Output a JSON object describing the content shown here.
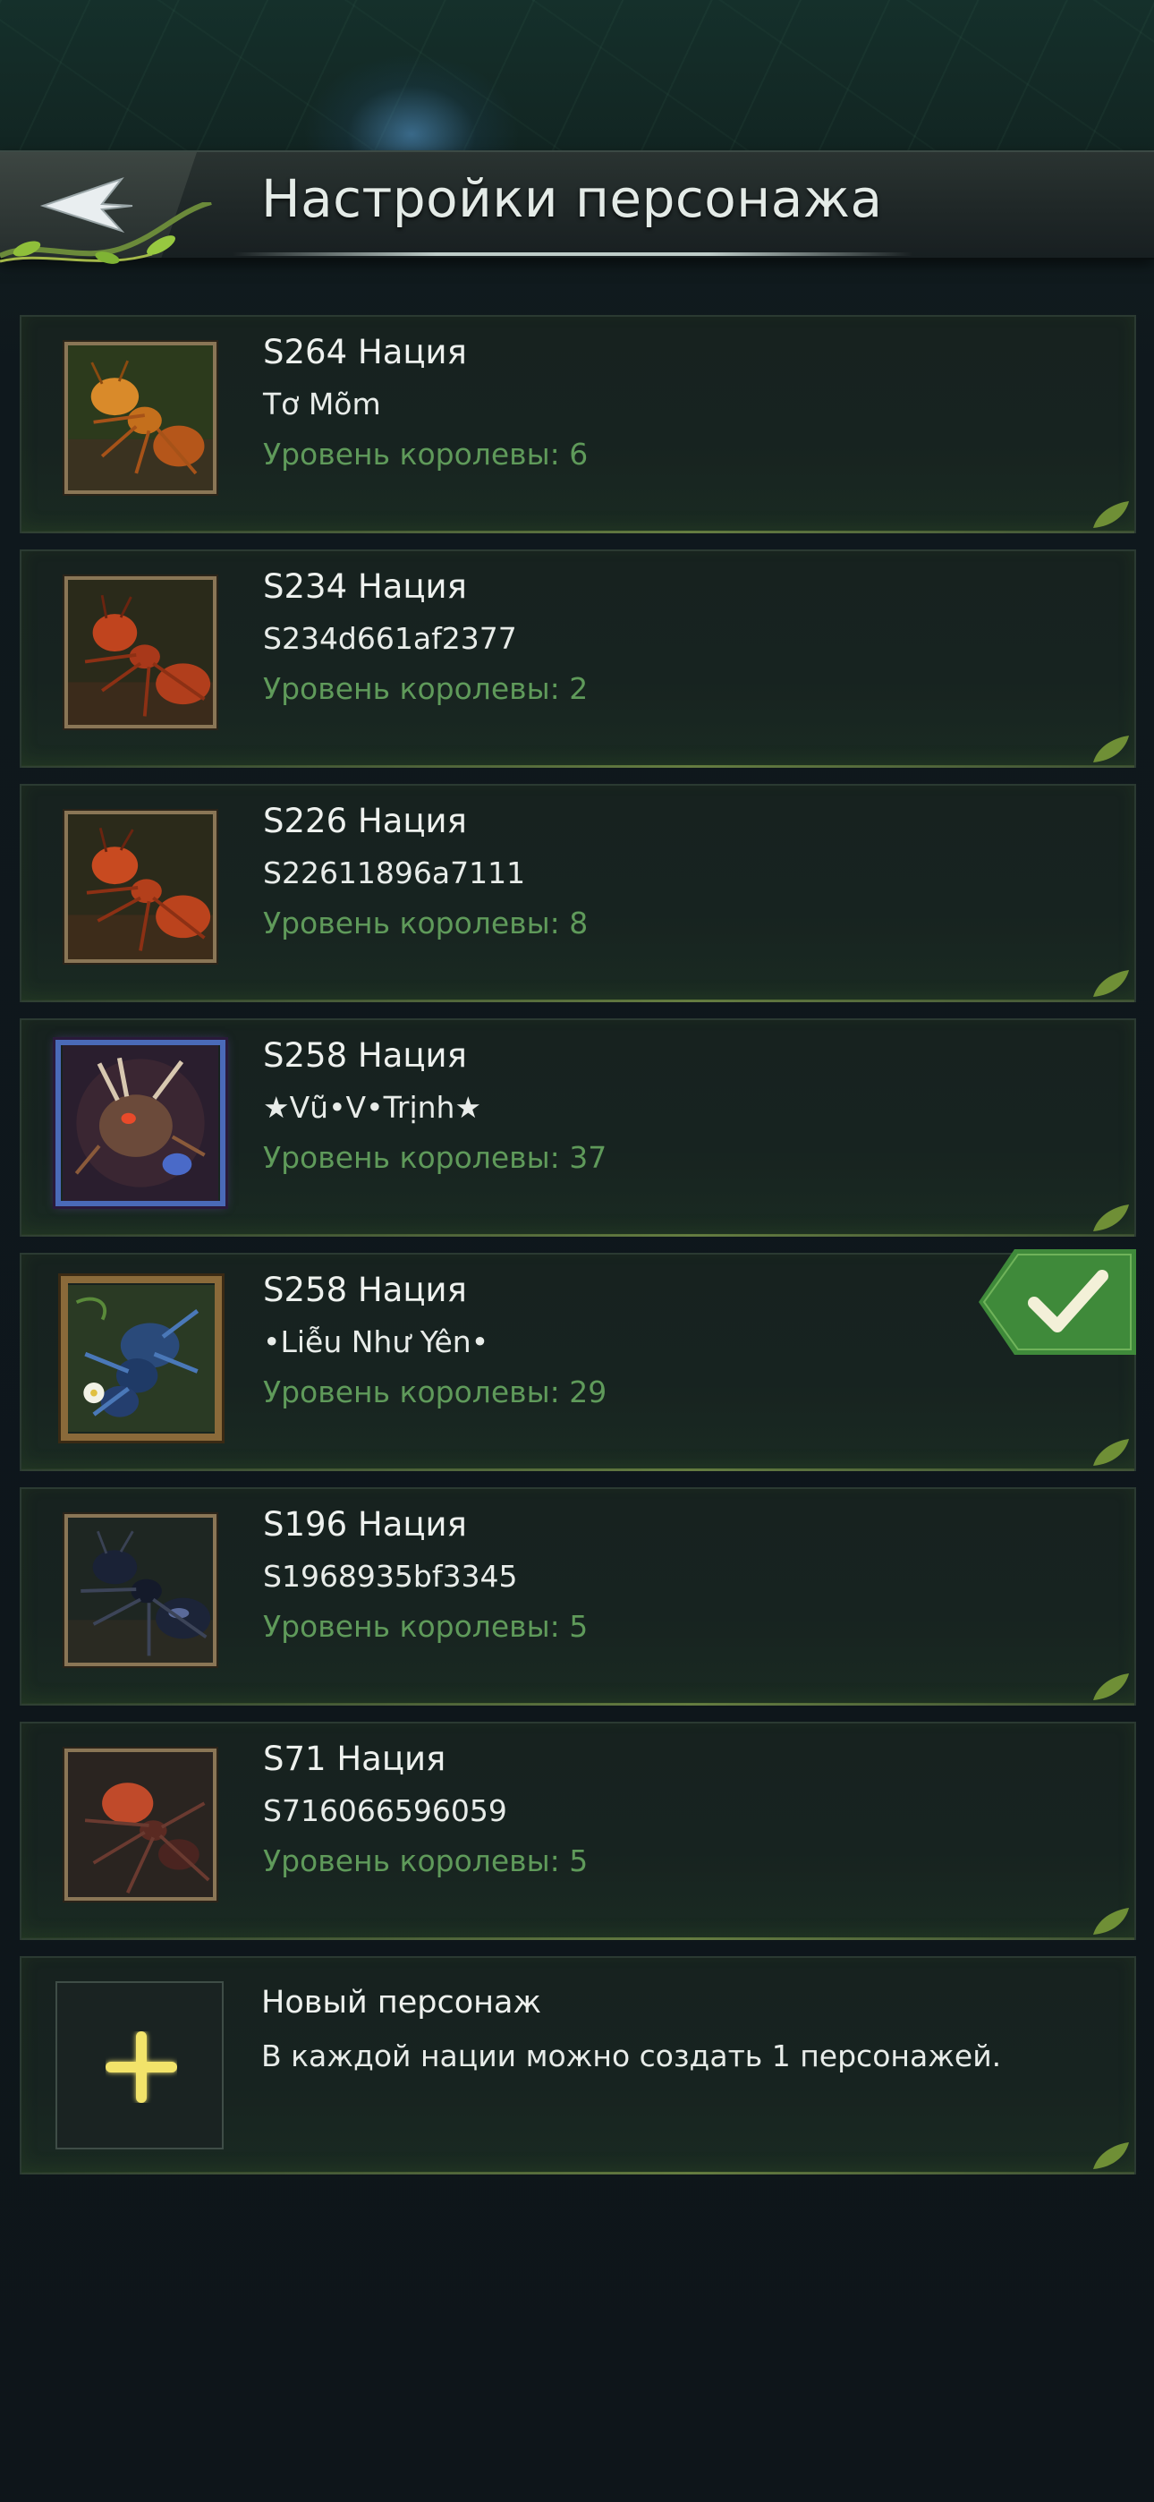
{
  "header": {
    "title": "Настройки персонажа",
    "back_icon": "back-arrow-icon"
  },
  "characters": [
    {
      "nation": "S264 Нация",
      "name": "Tơ Mõm",
      "level": "Уровень королевы: 6",
      "selected": false
    },
    {
      "nation": "S234 Нация",
      "name": "S234d661af2377",
      "level": "Уровень королевы: 2",
      "selected": false
    },
    {
      "nation": "S226 Нация",
      "name": "S22611896a7111",
      "level": "Уровень королевы: 8",
      "selected": false
    },
    {
      "nation": "S258 Нация",
      "name": "★Vũ•V•Trịnh★",
      "level": "Уровень королевы: 37",
      "selected": false
    },
    {
      "nation": "S258 Нация",
      "name": "•Liễu Như Yên•",
      "level": "Уровень королевы: 29",
      "selected": true
    },
    {
      "nation": "S196 Нация",
      "name": "S1968935bf3345",
      "level": "Уровень королевы: 5",
      "selected": false
    },
    {
      "nation": "S71 Нация",
      "name": "S716066596059",
      "level": "Уровень королевы: 5",
      "selected": false
    }
  ],
  "new_character": {
    "title": "Новый персонаж",
    "description": "В каждой нации можно создать 1 персонажей.",
    "icon": "plus-icon"
  },
  "colors": {
    "level_text": "#5f9a5a",
    "selected_badge": "#3f8a3a",
    "plus_icon": "#f2e36a"
  }
}
